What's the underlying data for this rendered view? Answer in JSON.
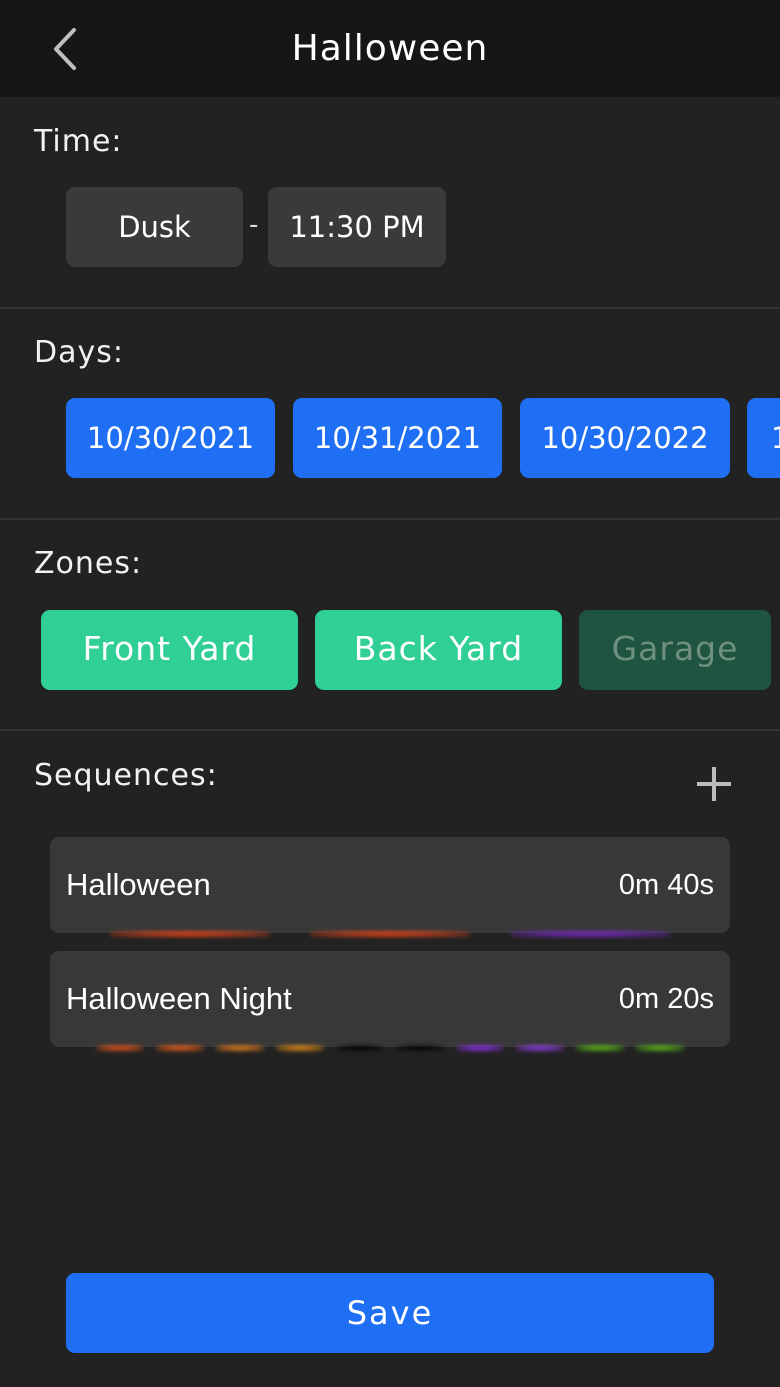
{
  "header": {
    "title": "Halloween",
    "back_icon": "chevron-left-icon"
  },
  "time": {
    "label": "Time:",
    "start": "Dusk",
    "separator": "-",
    "end": "11:30 PM"
  },
  "days": {
    "label": "Days:",
    "items": [
      "10/30/2021",
      "10/31/2021",
      "10/30/2022",
      "1"
    ]
  },
  "zones": {
    "label": "Zones:",
    "items": [
      {
        "label": "Front Yard",
        "selected": true
      },
      {
        "label": "Back Yard",
        "selected": true
      },
      {
        "label": "Garage",
        "selected": false
      }
    ]
  },
  "sequences": {
    "label": "Sequences:",
    "add_icon": "plus-icon",
    "items": [
      {
        "name": "Halloween",
        "duration": "0m 40s",
        "colors": [
          "#ff4a1a",
          "#ff4a1a",
          "#8a2be2"
        ]
      },
      {
        "name": "Halloween Night",
        "duration": "0m 20s",
        "colors": [
          "#ff5a1a",
          "#ff6a1a",
          "#ff8c1a",
          "#ff9a1a",
          "#000000",
          "#000000",
          "#9b30ff",
          "#a040ff",
          "#66d11a",
          "#66d11a"
        ]
      }
    ]
  },
  "footer": {
    "save_label": "Save"
  },
  "colors": {
    "accent_blue": "#1f6ff5",
    "zone_green": "#2fcf95",
    "background": "#222222"
  }
}
